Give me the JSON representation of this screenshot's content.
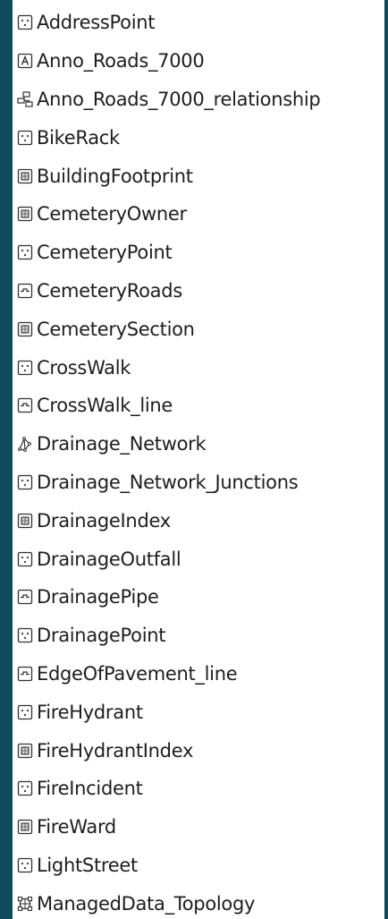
{
  "layer_list": {
    "items": [
      {
        "label": "AddressPoint",
        "icon": "point-feature-class-icon"
      },
      {
        "label": "Anno_Roads_7000",
        "icon": "annotation-feature-class-icon"
      },
      {
        "label": "Anno_Roads_7000_relationship",
        "icon": "relationship-class-icon"
      },
      {
        "label": "BikeRack",
        "icon": "point-feature-class-icon"
      },
      {
        "label": "BuildingFootprint",
        "icon": "polygon-feature-class-icon"
      },
      {
        "label": "CemeteryOwner",
        "icon": "polygon-feature-class-icon"
      },
      {
        "label": "CemeteryPoint",
        "icon": "point-feature-class-icon"
      },
      {
        "label": "CemeteryRoads",
        "icon": "line-feature-class-icon"
      },
      {
        "label": "CemeterySection",
        "icon": "polygon-feature-class-icon"
      },
      {
        "label": "CrossWalk",
        "icon": "point-feature-class-icon"
      },
      {
        "label": "CrossWalk_line",
        "icon": "line-feature-class-icon"
      },
      {
        "label": "Drainage_Network",
        "icon": "geometric-network-icon"
      },
      {
        "label": "Drainage_Network_Junctions",
        "icon": "point-feature-class-icon"
      },
      {
        "label": "DrainageIndex",
        "icon": "polygon-feature-class-icon"
      },
      {
        "label": "DrainageOutfall",
        "icon": "point-feature-class-icon"
      },
      {
        "label": "DrainagePipe",
        "icon": "line-feature-class-icon"
      },
      {
        "label": "DrainagePoint",
        "icon": "point-feature-class-icon"
      },
      {
        "label": "EdgeOfPavement_line",
        "icon": "line-feature-class-icon"
      },
      {
        "label": "FireHydrant",
        "icon": "point-feature-class-icon"
      },
      {
        "label": "FireHydrantIndex",
        "icon": "polygon-feature-class-icon"
      },
      {
        "label": "FireIncident",
        "icon": "point-feature-class-icon"
      },
      {
        "label": "FireWard",
        "icon": "polygon-feature-class-icon"
      },
      {
        "label": "LightStreet",
        "icon": "point-feature-class-icon"
      },
      {
        "label": "ManagedData_Topology",
        "icon": "topology-icon"
      }
    ]
  },
  "colors": {
    "background": "#0d4a5c",
    "panel": "#ffffff",
    "text": "#1e1e1e",
    "icon_stroke": "#333333"
  }
}
